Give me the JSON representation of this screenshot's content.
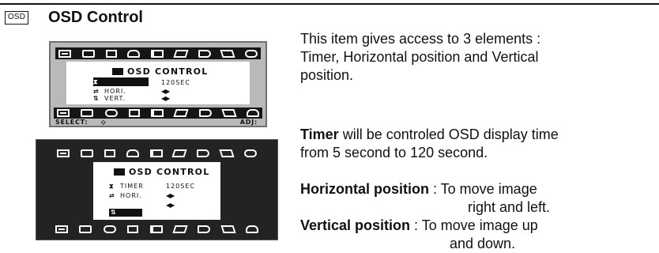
{
  "header": {
    "badge": "OSD",
    "title": "OSD Control"
  },
  "osd_screen_1": {
    "title": "OSD CONTROL",
    "timer_value": "120SEC",
    "hori_label": "HORI.",
    "vert_label": "VERT.",
    "select_label": "SELECT:",
    "adj_label": "ADJ:"
  },
  "osd_screen_2": {
    "title": "OSD CONTROL",
    "timer_label": "TIMER",
    "timer_value": "120SEC",
    "hori_label": "HORI."
  },
  "description": {
    "intro_1": "This item gives access to 3 elements :",
    "intro_2": "Timer, Horizontal position and Vertical",
    "intro_3": "position.",
    "timer_term": "Timer",
    "timer_text_1": " will be controled OSD display time",
    "timer_text_2": "from 5 second to 120 second.",
    "horizontal_term": "Horizontal position",
    "horizontal_text_1": " : To move image",
    "horizontal_text_2": "right and left.",
    "vertical_term": "Vertical position",
    "vertical_text_1": " : To move image up",
    "vertical_text_2": "and down."
  }
}
